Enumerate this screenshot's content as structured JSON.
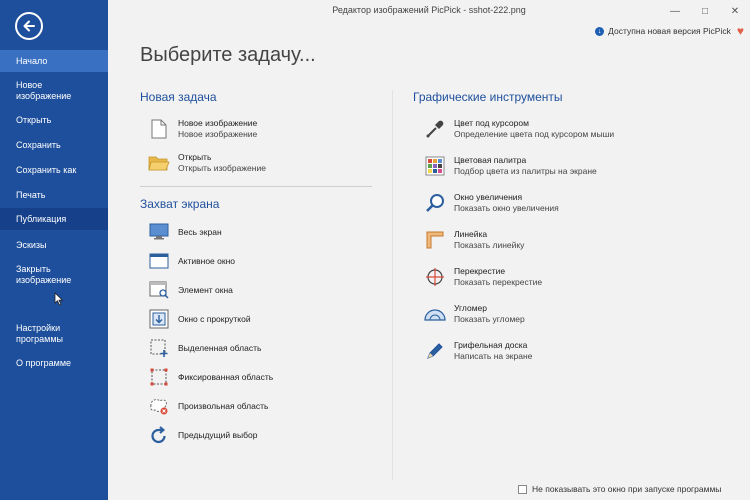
{
  "window": {
    "title": "Редактор изображений PicPick - sshot-222.png",
    "update_link": "Доступна новая версия PicPick"
  },
  "sidebar": {
    "items": [
      {
        "label": "Начало"
      },
      {
        "label": "Новое\nизображение"
      },
      {
        "label": "Открыть"
      },
      {
        "label": "Сохранить"
      },
      {
        "label": "Сохранить как"
      },
      {
        "label": "Печать"
      },
      {
        "label": "Публикация"
      },
      {
        "label": "Эскизы"
      },
      {
        "label": "Закрыть\nизображение"
      },
      {
        "label": "Настройки\nпрограммы"
      },
      {
        "label": "О программе"
      }
    ]
  },
  "main": {
    "title": "Выберите задачу...",
    "new_task": {
      "title": "Новая задача",
      "items": [
        {
          "label": "Новое изображение",
          "desc": "Новое изображение"
        },
        {
          "label": "Открыть",
          "desc": "Открыть изображение"
        }
      ]
    },
    "capture": {
      "title": "Захват экрана",
      "items": [
        {
          "label": "Весь экран"
        },
        {
          "label": "Активное окно"
        },
        {
          "label": "Элемент окна"
        },
        {
          "label": "Окно с прокруткой"
        },
        {
          "label": "Выделенная область"
        },
        {
          "label": "Фиксированная область"
        },
        {
          "label": "Произвольная область"
        },
        {
          "label": "Предыдущий выбор"
        }
      ]
    },
    "tools": {
      "title": "Графические инструменты",
      "items": [
        {
          "label": "Цвет под курсором",
          "desc": "Определение цвета под курсором мыши"
        },
        {
          "label": "Цветовая палитра",
          "desc": "Подбор цвета из палитры на экране"
        },
        {
          "label": "Окно увеличения",
          "desc": "Показать окно увеличения"
        },
        {
          "label": "Линейка",
          "desc": "Показать линейку"
        },
        {
          "label": "Перекрестие",
          "desc": "Показать перекрестие"
        },
        {
          "label": "Угломер",
          "desc": "Показать угломер"
        },
        {
          "label": "Грифельная доска",
          "desc": "Написать на экране"
        }
      ]
    }
  },
  "footer": {
    "dont_show": "Не показывать это окно при запуске программы"
  },
  "colors": {
    "sidebar": "#1e4f9c",
    "sidebar_active": "#3a70c2",
    "accent": "#1e4f9c"
  }
}
